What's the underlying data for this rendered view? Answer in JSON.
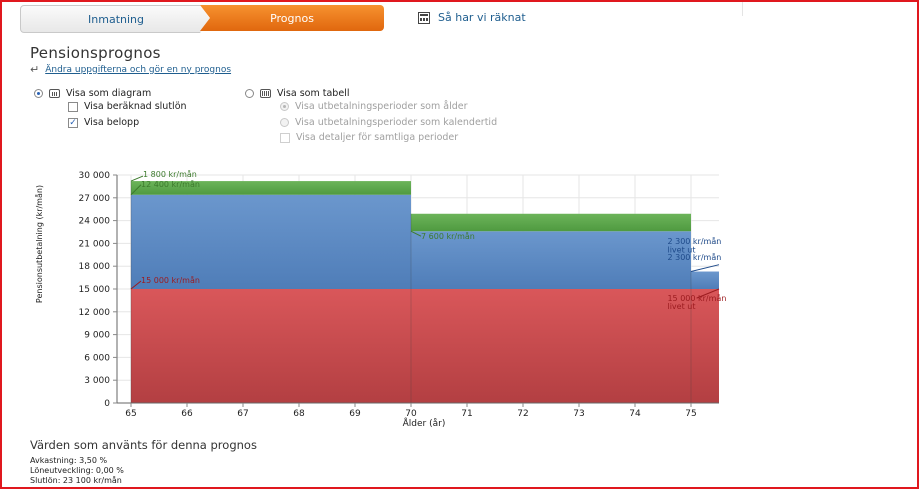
{
  "tabs": [
    {
      "label": "Inmatning",
      "active": false
    },
    {
      "label": "Prognos",
      "active": true
    }
  ],
  "calc_link": "Så har vi räknat",
  "page_title": "Pensionsprognos",
  "change_link": "Ändra uppgifterna och gör en ny prognos",
  "view_options": {
    "diagram": {
      "label": "Visa som diagram",
      "selected": true
    },
    "show_salary": {
      "label": "Visa beräknad slutlön",
      "checked": false
    },
    "show_amount": {
      "label": "Visa belopp",
      "checked": true
    },
    "table": {
      "label": "Visa som tabell",
      "selected": false
    },
    "periods_age": {
      "label": "Visa utbetalningsperioder som ålder",
      "selected": true,
      "disabled": true
    },
    "periods_calendar": {
      "label": "Visa utbetalningsperioder som kalendertid",
      "selected": false,
      "disabled": true
    },
    "show_details": {
      "label": "Visa detaljer för samtliga perioder",
      "checked": false,
      "disabled": true
    }
  },
  "colors": {
    "red": "#cf4a4c",
    "blue": "#5b8bc4",
    "green": "#5ea84e",
    "tab_active": "#f0801d",
    "link": "#1f5e8f"
  },
  "chart_data": {
    "type": "area",
    "xlabel": "Ålder (år)",
    "ylabel": "Pensionsutbetalning (kr/mån)",
    "x_ticks": [
      "65",
      "66",
      "67",
      "68",
      "69",
      "70",
      "71",
      "72",
      "73",
      "74",
      "75"
    ],
    "y_ticks": [
      "0",
      "3 000",
      "6 000",
      "9 000",
      "12 000",
      "15 000",
      "18 000",
      "21 000",
      "24 000",
      "27 000",
      "30 000"
    ],
    "xlim": [
      64.75,
      75.5
    ],
    "ylim": [
      0,
      30000
    ],
    "grid": true,
    "segments": [
      {
        "from": 65,
        "to": 70,
        "red": 15000,
        "blue": 12400,
        "green": 1800
      },
      {
        "from": 70,
        "to": 75,
        "red": 15000,
        "blue": 7600,
        "green": 2300
      },
      {
        "from": 75,
        "to": 75.5,
        "red": 15000,
        "blue": 2300,
        "green": 0
      }
    ],
    "annotations": [
      {
        "text": "1 800 kr/mån",
        "color": "#3c7a2c"
      },
      {
        "text": "12 400 kr/mån",
        "color": "#3c7a2c"
      },
      {
        "text": "15 000 kr/mån",
        "color": "#9b1b1f"
      },
      {
        "text": "7 600 kr/mån",
        "color": "#3c7a2c"
      },
      {
        "text": "2 300 kr/mån",
        "color": "#1e4a8a"
      },
      {
        "text": "livet ut",
        "color": "#1e4a8a"
      },
      {
        "text": "2 300 kr/mån",
        "color": "#1e4a8a"
      },
      {
        "text": "15 000 kr/mån",
        "color": "#9b1b1f"
      },
      {
        "text": "livet ut",
        "color": "#9b1b1f"
      }
    ]
  },
  "assumptions": {
    "title": "Värden som använts för denna prognos",
    "lines": [
      "Avkastning: 3,50 %",
      "Löneutveckling: 0,00 %",
      "Slutlön: 23 100 kr/mån"
    ]
  }
}
